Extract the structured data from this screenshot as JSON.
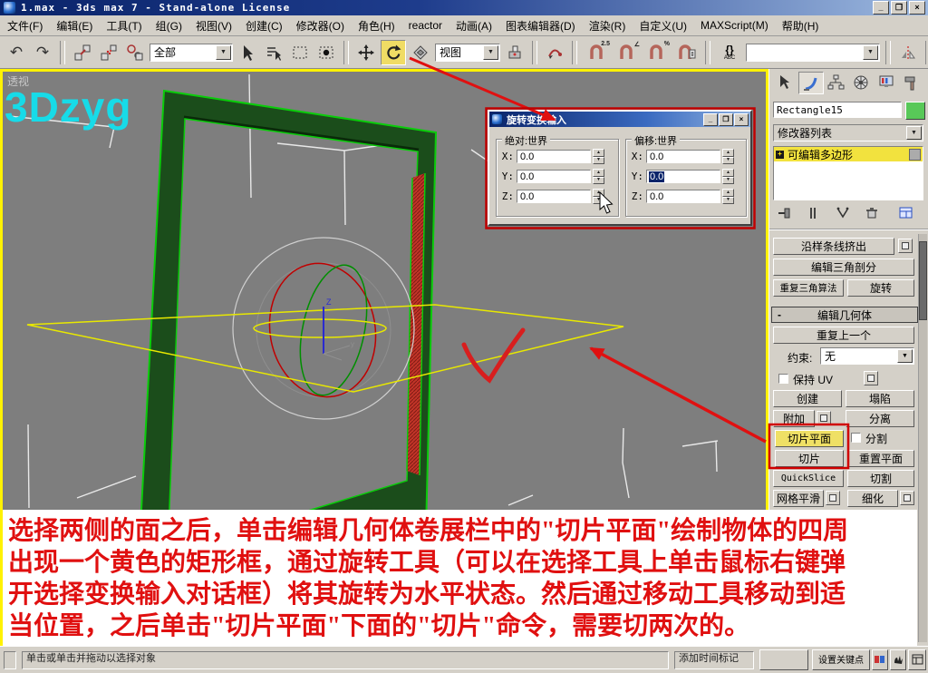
{
  "window": {
    "title": "1.max - 3ds max 7  - Stand-alone License",
    "minimize_glyph": "_",
    "restore_glyph": "❐",
    "close_glyph": "×"
  },
  "menubar": {
    "items": [
      "文件(F)",
      "编辑(E)",
      "工具(T)",
      "组(G)",
      "视图(V)",
      "创建(C)",
      "修改器(O)",
      "角色(H)",
      "reactor",
      "动画(A)",
      "图表编辑器(D)",
      "渲染(R)",
      "自定义(U)",
      "MAXScript(M)",
      "帮助(H)"
    ]
  },
  "toolbar": {
    "selection_filter_value": "全部",
    "ref_coord_value": "视图",
    "named_selection_value": "",
    "snap_25_label": "2.5",
    "snap_angle_label": "∠",
    "snap_percent_label": "%",
    "named_sel_braces": "{}",
    "named_sel_abc": "ABC"
  },
  "viewport": {
    "label": "透视",
    "watermark": "3Dzyg"
  },
  "dialog": {
    "title": "旋转变换输入",
    "groups": [
      {
        "label": "绝对:世界",
        "rows": [
          {
            "axis": "X:",
            "value": "0.0"
          },
          {
            "axis": "Y:",
            "value": "0.0"
          },
          {
            "axis": "Z:",
            "value": "0.0"
          }
        ]
      },
      {
        "label": "偏移:世界",
        "rows": [
          {
            "axis": "X:",
            "value": "0.0"
          },
          {
            "axis": "Y:",
            "value": "0.0"
          },
          {
            "axis": "Z:",
            "value": "0.0"
          }
        ]
      }
    ]
  },
  "side_panel": {
    "object_name": "Rectangle15",
    "modifier_list_label": "修改器列表",
    "stack_expand_glyph": "+",
    "stack_item": "可编辑多边形",
    "rollout_top": {
      "extrude_along_spline": "沿样条线挤出",
      "edit_triangulation": "编辑三角剖分",
      "retriangulate": "重复三角算法",
      "turn": "旋转"
    },
    "edit_geometry": {
      "collapse_glyph": "-",
      "header": "编辑几何体",
      "repeat_last": "重复上一个",
      "constraints_label": "约束:",
      "constraints_value": "无",
      "preserve_uv": "保持 UV",
      "create": "创建",
      "collapse": "塌陷",
      "attach": "附加",
      "detach": "分离",
      "slice_plane": "切片平面",
      "split": "分割",
      "slice": "切片",
      "reset_plane": "重置平面",
      "quickslice": "QuickSlice",
      "cut": "切割",
      "meshsmooth": "网格平滑",
      "tessellate": "细化"
    }
  },
  "tutorial_overlay": {
    "lines": [
      "选择两侧的面之后，单击编辑几何体卷展栏中的\"切片平面\"绘制物体的四周",
      "出现一个黄色的矩形框，通过旋转工具（可以在选择工具上单击鼠标右键弹",
      "开选择变换输入对话框）将其旋转为水平状态。然后通过移动工具移动到适",
      "当位置，之后单击\"切片平面\"下面的\"切片\"命令，需要切两次的。"
    ]
  },
  "statusbar": {
    "prompt": "单击或单击并拖动以选择对象",
    "add_time_tag": "添加时间标记",
    "set_key": "设置关键点"
  }
}
